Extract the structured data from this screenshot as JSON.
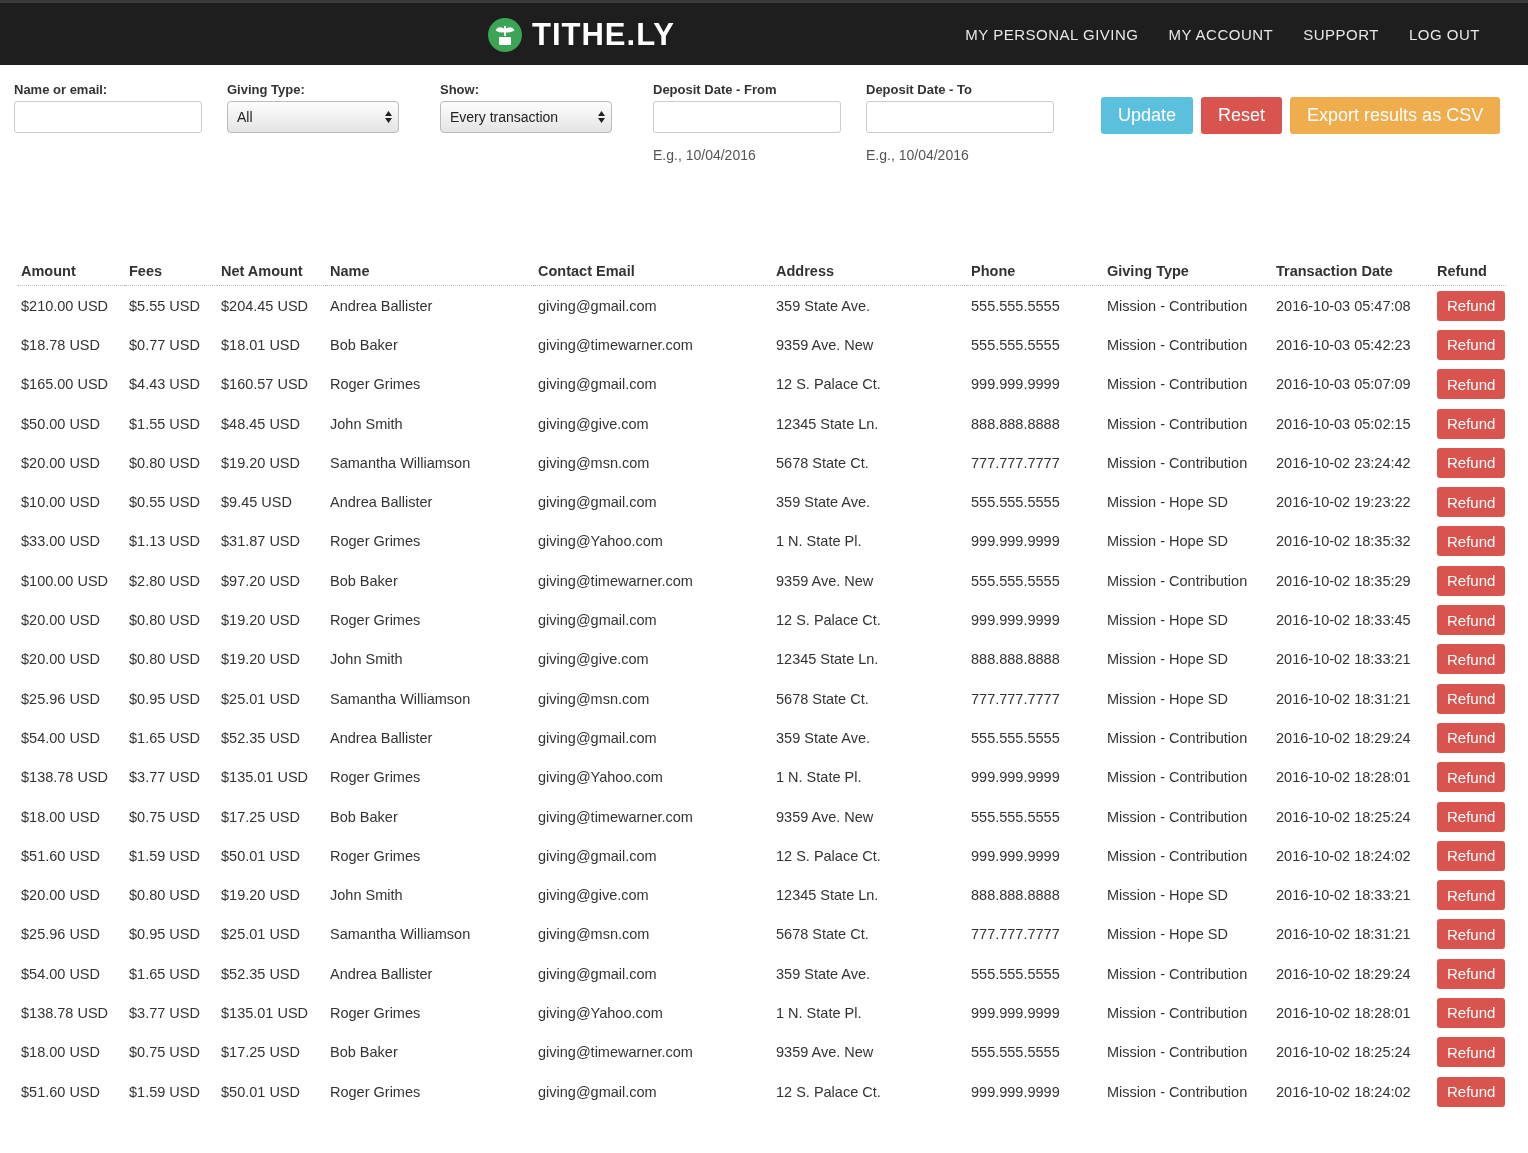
{
  "header": {
    "logo": "TITHE.LY",
    "nav": [
      "MY PERSONAL GIVING",
      "MY ACCOUNT",
      "SUPPORT",
      "LOG OUT"
    ]
  },
  "filters": [
    {
      "kind": "text",
      "label": "Name or email:"
    },
    {
      "kind": "select",
      "label": "Giving Type:",
      "value": "All"
    },
    {
      "kind": "select",
      "label": "Show:",
      "value": "Every transaction"
    },
    {
      "kind": "date",
      "label": "Deposit Date - From",
      "hint": "E.g., 10/04/2016"
    },
    {
      "kind": "date",
      "label": "Deposit Date - To",
      "hint": "E.g., 10/04/2016"
    }
  ],
  "buttons": [
    {
      "label": "Update",
      "kind": "info"
    },
    {
      "label": "Reset",
      "kind": "danger"
    },
    {
      "label": "Export results as CSV",
      "kind": "warning"
    }
  ],
  "table": {
    "columns": [
      "Amount",
      "Fees",
      "Net Amount",
      "Name",
      "Contact Email",
      "Address",
      "Phone",
      "Giving Type",
      "Transaction Date",
      "Refund"
    ],
    "rows": [
      [
        "$210.00 USD",
        "$5.55 USD",
        "$204.45 USD",
        "Andrea Ballister",
        "giving@gmail.com",
        "359 State Ave.",
        "555.555.5555",
        "Mission - Contribution",
        "2016-10-03 05:47:08",
        "Refund"
      ],
      [
        "$18.78 USD",
        "$0.77 USD",
        "$18.01 USD",
        "Bob Baker",
        "giving@timewarner.com",
        "9359 Ave. New",
        "555.555.5555",
        "Mission - Contribution",
        "2016-10-03 05:42:23",
        "Refund"
      ],
      [
        "$165.00 USD",
        "$4.43 USD",
        "$160.57 USD",
        "Roger Grimes",
        "giving@gmail.com",
        "12 S. Palace Ct.",
        "999.999.9999",
        "Mission - Contribution",
        "2016-10-03 05:07:09",
        "Refund"
      ],
      [
        "$50.00 USD",
        "$1.55 USD",
        "$48.45 USD",
        "John Smith",
        "giving@give.com",
        "12345 State Ln.",
        "888.888.8888",
        "Mission - Contribution",
        "2016-10-03 05:02:15",
        "Refund"
      ],
      [
        "$20.00 USD",
        "$0.80 USD",
        "$19.20 USD",
        "Samantha Williamson",
        "giving@msn.com",
        "5678 State Ct.",
        "777.777.7777",
        "Mission - Contribution",
        "2016-10-02 23:24:42",
        "Refund"
      ],
      [
        "$10.00 USD",
        "$0.55 USD",
        "$9.45 USD",
        "Andrea Ballister",
        "giving@gmail.com",
        "359 State Ave.",
        "555.555.5555",
        "Mission - Hope SD",
        "2016-10-02 19:23:22",
        "Refund"
      ],
      [
        "$33.00 USD",
        "$1.13 USD",
        "$31.87 USD",
        "Roger Grimes",
        "giving@Yahoo.com",
        "1 N. State Pl.",
        "999.999.9999",
        "Mission - Hope SD",
        "2016-10-02 18:35:32",
        "Refund"
      ],
      [
        "$100.00 USD",
        "$2.80 USD",
        "$97.20 USD",
        "Bob Baker",
        "giving@timewarner.com",
        "9359 Ave. New",
        "555.555.5555",
        "Mission - Contribution",
        "2016-10-02 18:35:29",
        "Refund"
      ],
      [
        "$20.00 USD",
        "$0.80 USD",
        "$19.20 USD",
        "Roger Grimes",
        "giving@gmail.com",
        "12 S. Palace Ct.",
        "999.999.9999",
        "Mission - Hope SD",
        "2016-10-02 18:33:45",
        "Refund"
      ],
      [
        "$20.00 USD",
        "$0.80 USD",
        "$19.20 USD",
        "John Smith",
        "giving@give.com",
        "12345 State Ln.",
        "888.888.8888",
        "Mission - Hope SD",
        "2016-10-02 18:33:21",
        "Refund"
      ],
      [
        "$25.96 USD",
        "$0.95 USD",
        "$25.01 USD",
        "Samantha Williamson",
        "giving@msn.com",
        "5678 State Ct.",
        "777.777.7777",
        "Mission - Hope SD",
        "2016-10-02 18:31:21",
        "Refund"
      ],
      [
        "$54.00 USD",
        "$1.65 USD",
        "$52.35 USD",
        "Andrea Ballister",
        "giving@gmail.com",
        "359 State Ave.",
        "555.555.5555",
        "Mission - Contribution",
        "2016-10-02 18:29:24",
        "Refund"
      ],
      [
        "$138.78 USD",
        "$3.77 USD",
        "$135.01 USD",
        "Roger Grimes",
        "giving@Yahoo.com",
        "1 N. State Pl.",
        "999.999.9999",
        "Mission - Contribution",
        "2016-10-02 18:28:01",
        "Refund"
      ],
      [
        "$18.00 USD",
        "$0.75 USD",
        "$17.25 USD",
        "Bob Baker",
        "giving@timewarner.com",
        "9359 Ave. New",
        "555.555.5555",
        "Mission - Contribution",
        "2016-10-02 18:25:24",
        "Refund"
      ],
      [
        "$51.60 USD",
        "$1.59 USD",
        "$50.01 USD",
        "Roger Grimes",
        "giving@gmail.com",
        "12 S. Palace Ct.",
        "999.999.9999",
        "Mission - Contribution",
        "2016-10-02 18:24:02",
        "Refund"
      ],
      [
        "$20.00 USD",
        "$0.80 USD",
        "$19.20 USD",
        "John Smith",
        "giving@give.com",
        "12345 State Ln.",
        "888.888.8888",
        "Mission - Hope SD",
        "2016-10-02 18:33:21",
        "Refund"
      ],
      [
        "$25.96 USD",
        "$0.95 USD",
        "$25.01 USD",
        "Samantha Williamson",
        "giving@msn.com",
        "5678 State Ct.",
        "777.777.7777",
        "Mission - Hope SD",
        "2016-10-02 18:31:21",
        "Refund"
      ],
      [
        "$54.00 USD",
        "$1.65 USD",
        "$52.35 USD",
        "Andrea Ballister",
        "giving@gmail.com",
        "359 State Ave.",
        "555.555.5555",
        "Mission - Contribution",
        "2016-10-02 18:29:24",
        "Refund"
      ],
      [
        "$138.78 USD",
        "$3.77 USD",
        "$135.01 USD",
        "Roger Grimes",
        "giving@Yahoo.com",
        "1 N. State Pl.",
        "999.999.9999",
        "Mission - Contribution",
        "2016-10-02 18:28:01",
        "Refund"
      ],
      [
        "$18.00 USD",
        "$0.75 USD",
        "$17.25 USD",
        "Bob Baker",
        "giving@timewarner.com",
        "9359 Ave. New",
        "555.555.5555",
        "Mission - Contribution",
        "2016-10-02 18:25:24",
        "Refund"
      ],
      [
        "$51.60 USD",
        "$1.59 USD",
        "$50.01 USD",
        "Roger Grimes",
        "giving@gmail.com",
        "12 S. Palace Ct.",
        "999.999.9999",
        "Mission - Contribution",
        "2016-10-02 18:24:02",
        "Refund"
      ]
    ]
  }
}
